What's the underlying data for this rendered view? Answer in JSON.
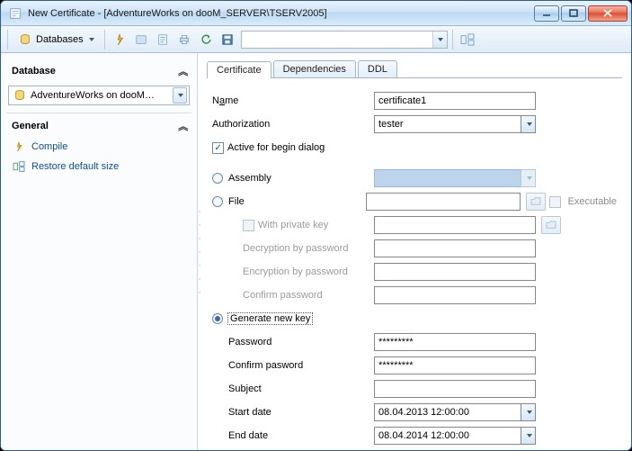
{
  "window": {
    "title": "New Certificate - [AdventureWorks on dooM_SERVER\\TSERV2005]"
  },
  "toolbar": {
    "databases_label": "Databases"
  },
  "sidebar": {
    "group_database": "Database",
    "db_value": "AdventureWorks on dooM…",
    "group_general": "General",
    "compile": "Compile",
    "restore": "Restore default size"
  },
  "tabs": {
    "certificate": "Certificate",
    "dependencies": "Dependencies",
    "ddl": "DDL"
  },
  "form": {
    "name_label_pre": "N",
    "name_label_u": "a",
    "name_label_post": "me",
    "name_value": "certificate1",
    "auth_label": "Authorization",
    "auth_value": "tester",
    "active_label": "Active for begin dialog",
    "active_checked": "✓",
    "assembly_label": "Assembly",
    "file_label": "File",
    "with_private_key": "With private key",
    "decryption": "Decryption by password",
    "encryption": "Encryption by password",
    "confirm_password1": "Confirm password",
    "generate_label": "Generate new key",
    "password_label": "Password",
    "password_value": "*********",
    "confirm_password2": "Confirm pasword",
    "confirm_value": "*********",
    "subject_label": "Subject",
    "subject_value": "",
    "start_label": "Start date",
    "start_value": "08.04.2013 12:00:00",
    "end_label": "End date",
    "end_value": "08.04.2014 12:00:00",
    "executable": "Executable"
  }
}
